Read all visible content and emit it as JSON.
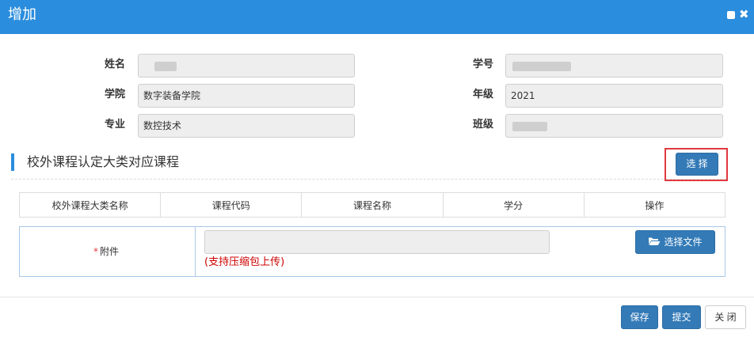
{
  "window": {
    "title": "增加"
  },
  "form": {
    "name_label": "姓名",
    "student_id_label": "学号",
    "college_label": "学院",
    "college_value": "数字装备学院",
    "grade_label": "年级",
    "grade_value": "2021",
    "major_label": "专业",
    "major_value": "数控技术",
    "class_label": "班级"
  },
  "section": {
    "title": "校外课程认定大类对应课程",
    "select_button": "选 择"
  },
  "table": {
    "headers": [
      "校外课程大类名称",
      "课程代码",
      "课程名称",
      "学分",
      "操作"
    ]
  },
  "attachment": {
    "required_mark": "*",
    "label": "附件",
    "choose_file_button": "选择文件",
    "hint": "(支持压缩包上传)"
  },
  "footer": {
    "save": "保存",
    "submit": "提交",
    "close": "关 闭"
  },
  "colors": {
    "titlebar": "#2b8ddd",
    "primary_button": "#337ab7",
    "highlight_border": "#e0393e",
    "hint_text": "#cc0000"
  }
}
